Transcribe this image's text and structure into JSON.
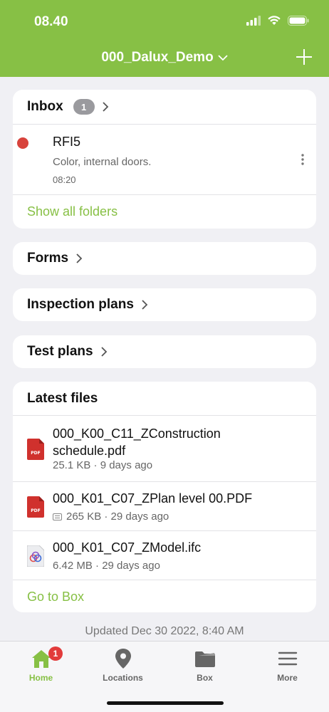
{
  "status_bar": {
    "time": "08.40"
  },
  "header": {
    "project": "000_Dalux_Demo"
  },
  "inbox": {
    "title": "Inbox",
    "count": "1",
    "item": {
      "title": "RFI5",
      "subtitle": "Color, internal doors.",
      "time": "08:20"
    },
    "show_all": "Show all folders"
  },
  "forms": {
    "title": "Forms"
  },
  "inspection": {
    "title": "Inspection plans"
  },
  "tests": {
    "title": "Test plans"
  },
  "latest_files": {
    "title": "Latest files",
    "files": [
      {
        "name_line1": "000_K00_C11_ZConstruction",
        "name_line2": "schedule.pdf",
        "meta": "25.1 KB · 9 days ago",
        "type": "pdf"
      },
      {
        "name": "000_K01_C07_ZPlan level 00.PDF",
        "meta": "265 KB · 29 days ago",
        "type": "pdf"
      },
      {
        "name": "000_K01_C07_ZModel.ifc",
        "meta": "6.42 MB · 29 days ago",
        "type": "ifc"
      }
    ],
    "go_to_box": "Go to Box"
  },
  "updated": "Updated Dec 30 2022, 8:40 AM",
  "tabbar": {
    "home": "Home",
    "home_badge": "1",
    "locations": "Locations",
    "box": "Box",
    "more": "More"
  },
  "colors": {
    "brand": "#87c045",
    "badge_red": "#e23b3b",
    "rfi_red": "#d8433c"
  }
}
